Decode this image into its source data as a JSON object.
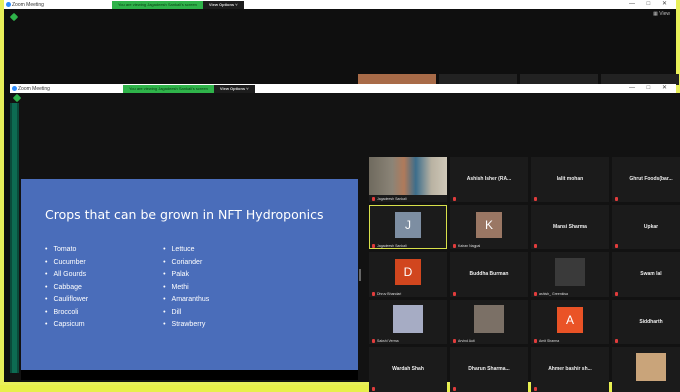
{
  "back_window": {
    "title": "Zoom Meeting",
    "banner": "You are viewing Jagadeesh Sankali's screen",
    "view_options": "View Options ˅",
    "view_label": "View",
    "controls": "— □ ✕"
  },
  "front_window": {
    "title": "Zoom Meeting",
    "banner": "You are viewing Jagadeesh Sankali's screen",
    "view_options": "View Options ˅",
    "controls": "— □ ✕"
  },
  "slide": {
    "title": "Crops that can be grown in NFT Hydroponics",
    "col1": [
      "Tomato",
      "Cucumber",
      "All Gourds",
      "Cabbage",
      "Cauliflower",
      "Broccoli",
      "Capsicum"
    ],
    "col2": [
      "Lettuce",
      "Coriander",
      "Palak",
      "Methi",
      "Amaranthus",
      "Dill",
      "Strawberry"
    ]
  },
  "participants": [
    {
      "name": "",
      "label": "Jagadeesh Sankali",
      "type": "video"
    },
    {
      "name": "Ashish Isher (RA...",
      "label": "",
      "type": "name"
    },
    {
      "name": "lalit mohan",
      "label": "",
      "type": "name"
    },
    {
      "name": "Ghrut Foods(bar...",
      "label": "",
      "type": "name"
    },
    {
      "name": "",
      "label": "Jagadeesh Sankali",
      "type": "avatar",
      "letter": "J",
      "color": "#7d8ea2",
      "active": true
    },
    {
      "name": "",
      "label": "Kairan Nagpal",
      "type": "avatar",
      "letter": "K",
      "color": "#9a7764"
    },
    {
      "name": "Mansi Sharma",
      "label": "",
      "type": "name"
    },
    {
      "name": "Upkar",
      "label": "",
      "type": "name"
    },
    {
      "name": "",
      "label": "Dhruv Bhandari",
      "type": "avatar",
      "letter": "D",
      "color": "#d1461e"
    },
    {
      "name": "Buddha Burman",
      "label": "",
      "type": "name"
    },
    {
      "name": "",
      "label": "ashish_ Greenkisa",
      "type": "image",
      "color": "#3a3a3a"
    },
    {
      "name": "Swam lal",
      "label": "",
      "type": "name"
    },
    {
      "name": "",
      "label": "Sakshi Verma",
      "type": "image",
      "color": "#a6acc4"
    },
    {
      "name": "",
      "label": "Arvind Auti",
      "type": "image",
      "color": "#7b7066"
    },
    {
      "name": "",
      "label": "Amit Sharma",
      "type": "avatar",
      "letter": "A",
      "color": "#ea5326"
    },
    {
      "name": "Siddharth",
      "label": "",
      "type": "name"
    },
    {
      "name": "Wardah Shah",
      "label": "",
      "type": "name"
    },
    {
      "name": "Dharun Sharma...",
      "label": "",
      "type": "name"
    },
    {
      "name": "Ahmer bashir sh...",
      "label": "",
      "type": "name"
    },
    {
      "name": "",
      "label": "",
      "type": "image",
      "color": "#c9a47a"
    }
  ]
}
